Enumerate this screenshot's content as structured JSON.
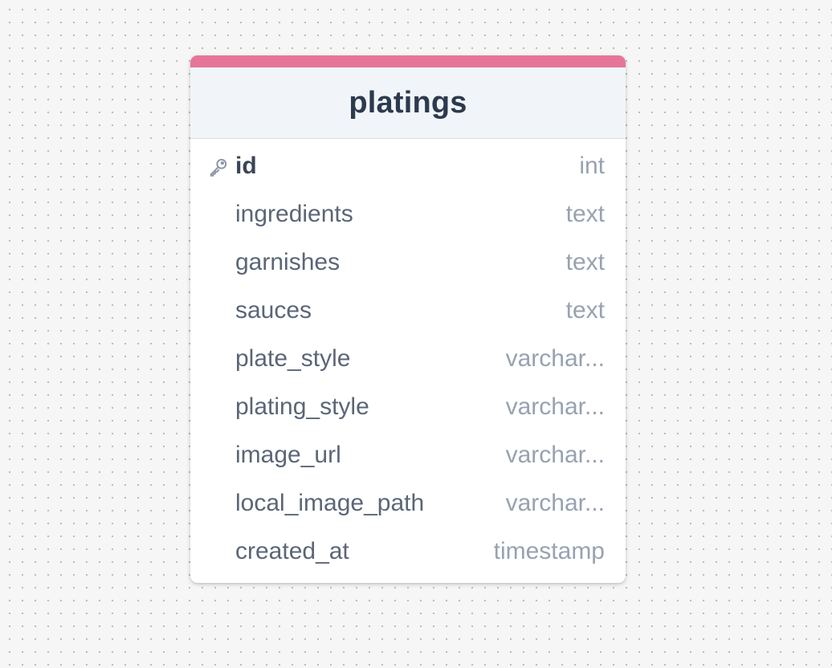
{
  "table": {
    "name": "platings",
    "accent_color": "#e57699",
    "columns": [
      {
        "name": "id",
        "type": "int",
        "primary_key": true,
        "icon": "key-icon"
      },
      {
        "name": "ingredients",
        "type": "text"
      },
      {
        "name": "garnishes",
        "type": "text"
      },
      {
        "name": "sauces",
        "type": "text"
      },
      {
        "name": "plate_style",
        "type": "varchar..."
      },
      {
        "name": "plating_style",
        "type": "varchar..."
      },
      {
        "name": "image_url",
        "type": "varchar..."
      },
      {
        "name": "local_image_path",
        "type": "varchar..."
      },
      {
        "name": "created_at",
        "type": "timestamp"
      }
    ]
  }
}
